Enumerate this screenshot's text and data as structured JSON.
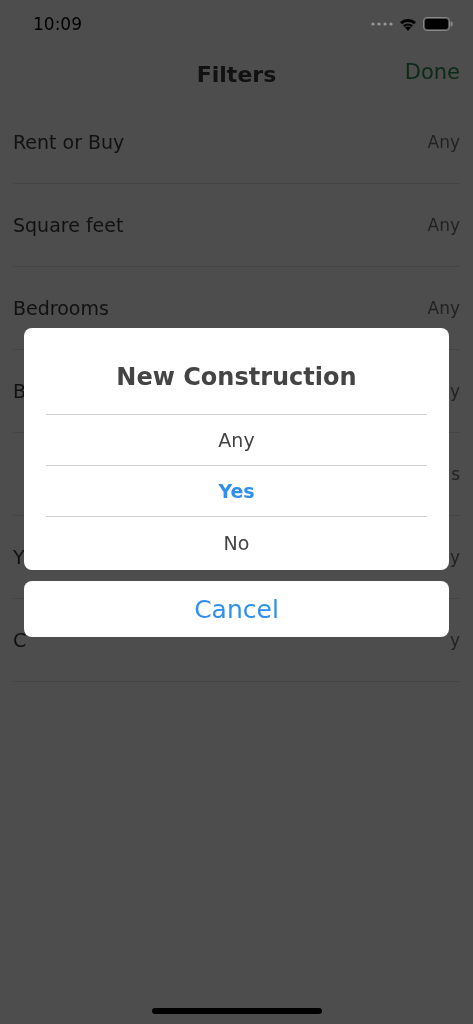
{
  "status_bar": {
    "time": "10:09"
  },
  "nav": {
    "title": "Filters",
    "done": "Done"
  },
  "rows": [
    {
      "label": "Rent or Buy",
      "value": "Any"
    },
    {
      "label": "Square feet",
      "value": "Any"
    },
    {
      "label": "Bedrooms",
      "value": "Any"
    },
    {
      "label": "B",
      "value": "y"
    },
    {
      "value": "s"
    },
    {
      "label": "Y",
      "value": "y"
    },
    {
      "label": "C",
      "value": "y"
    }
  ],
  "dialog": {
    "title": "New Construction",
    "options": [
      {
        "label": "Any",
        "selected": false
      },
      {
        "label": "Yes",
        "selected": true
      },
      {
        "label": "No",
        "selected": false
      }
    ],
    "cancel": "Cancel"
  }
}
